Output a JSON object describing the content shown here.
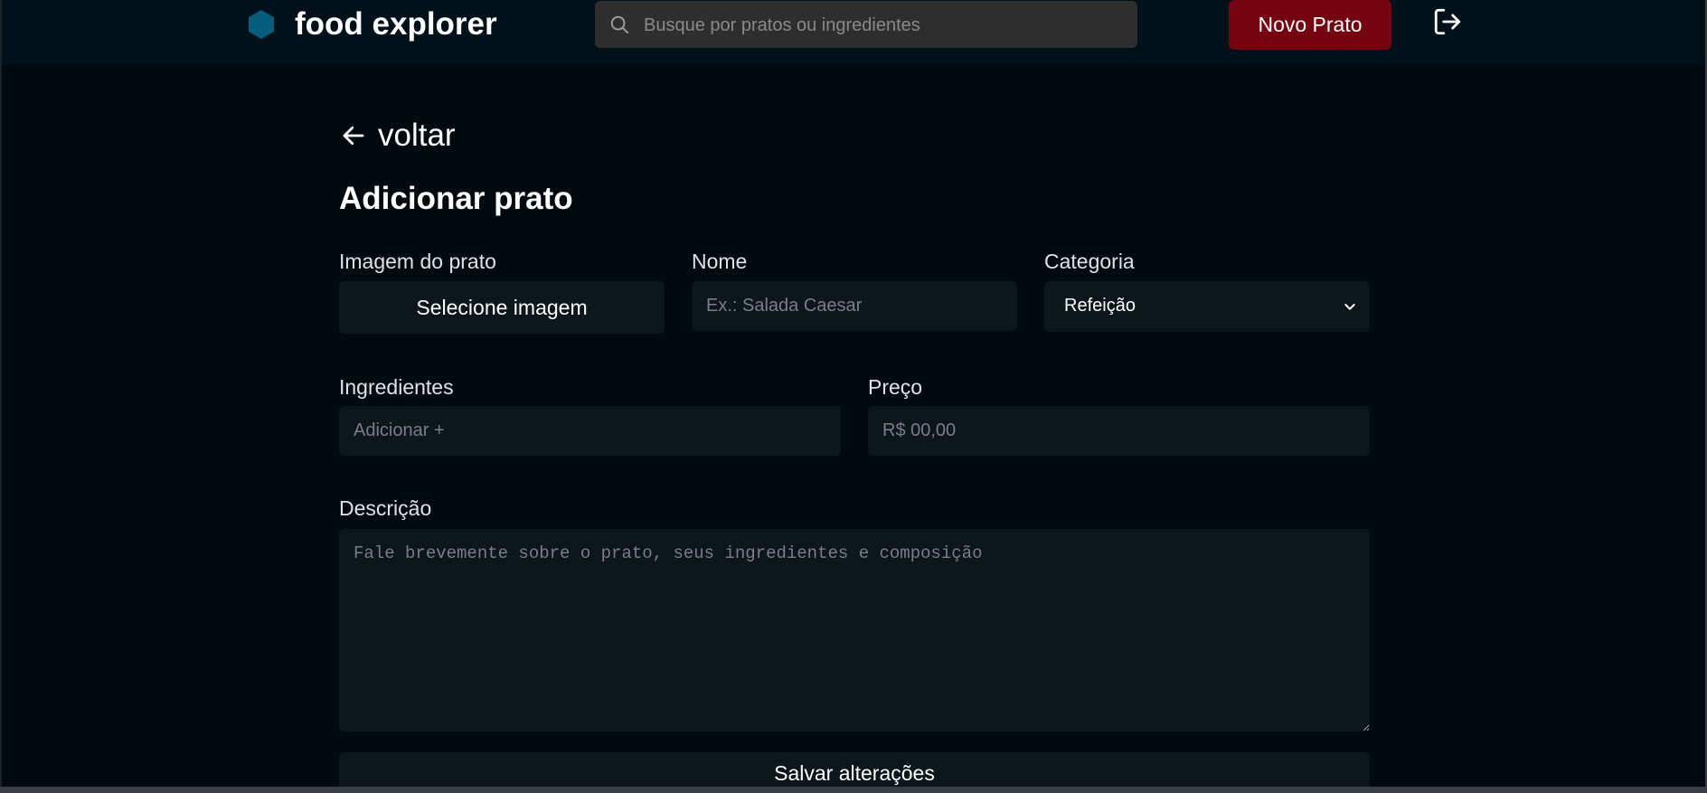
{
  "header": {
    "logo_text": "food explorer",
    "search_placeholder": "Busque por pratos ou ingredientes",
    "new_dish_label": "Novo Prato",
    "logo_color": "#065E7C",
    "button_color": "#750310"
  },
  "nav": {
    "back_label": "voltar"
  },
  "page": {
    "title": "Adicionar prato"
  },
  "form": {
    "image_label": "Imagem do prato",
    "image_button": "Selecione imagem",
    "name_label": "Nome",
    "name_placeholder": "Ex.: Salada Caesar",
    "category_label": "Categoria",
    "category_value": "Refeição",
    "ingredients_label": "Ingredientes",
    "ingredients_placeholder": "Adicionar +",
    "price_label": "Preço",
    "price_placeholder": "R$ 00,00",
    "description_label": "Descrição",
    "description_placeholder": "Fale brevemente sobre o prato, seus ingredientes e composição",
    "save_label": "Salvar alterações"
  }
}
